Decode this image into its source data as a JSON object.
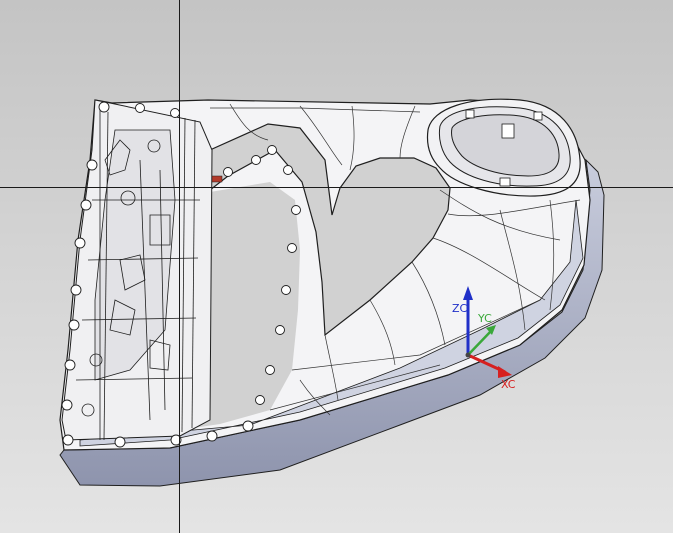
{
  "viewport": {
    "background_top": "#c4c4c4",
    "background_bottom": "#e4e4e4",
    "crosshair_color": "#1a1a1a"
  },
  "model": {
    "surface_color": "#f4f4f6",
    "shaded_color": "#aab0c8",
    "edge_color": "#1f1f1f",
    "feature_color": "#b23a2a"
  },
  "triad": {
    "x_label": "XC",
    "y_label": "YC",
    "z_label": "ZC",
    "x_color": "#d62020",
    "y_color": "#3aa83a",
    "z_color": "#2030c8"
  }
}
